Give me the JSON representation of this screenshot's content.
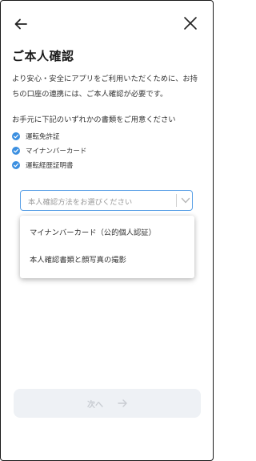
{
  "header": {
    "back_icon": "arrow-left-icon",
    "close_icon": "close-x-icon"
  },
  "page": {
    "title": "ご本人確認",
    "description": "より安心・安全にアプリをご利用いただくために、お持ちの口座の連携には、ご本人確認が必要です。",
    "prepare_text": "お手元に下記のいずれかの書類をご用意ください",
    "documents": [
      "運転免許証",
      "マイナンバーカード",
      "運転経歴証明書"
    ]
  },
  "method_select": {
    "placeholder": "本人確認方法をお選びください",
    "options": [
      "マイナンバーカード（公的個人認証）",
      "本人確認書類と顔写真の撮影"
    ]
  },
  "footer": {
    "next_label": "次へ"
  },
  "colors": {
    "accent": "#3b8fe0",
    "select_border": "#5aa0e6",
    "button_disabled_bg": "#eef1f5",
    "button_disabled_text": "#c8ccd2"
  }
}
